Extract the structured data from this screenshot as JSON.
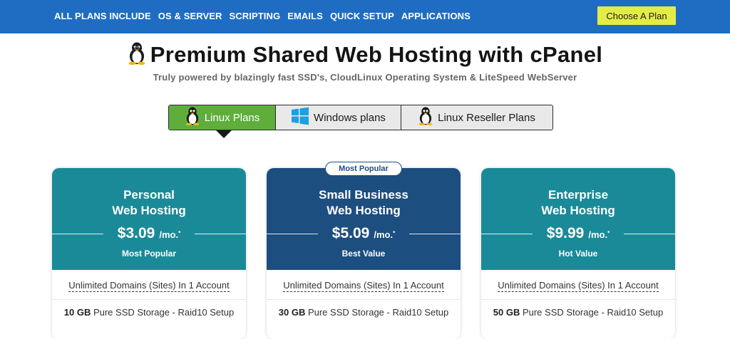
{
  "nav": {
    "items": [
      "ALL PLANS INCLUDE",
      "OS & SERVER",
      "SCRIPTING",
      "EMAILS",
      "QUICK SETUP",
      "APPLICATIONS"
    ],
    "cta_label": "Choose A Plan"
  },
  "header": {
    "title": "Premium Shared Web Hosting with cPanel",
    "subtitle": "Truly powered by blazingly fast SSD's, CloudLinux Operating System & LiteSpeed WebServer",
    "title_icon": "linux-tux-icon"
  },
  "tabs": [
    {
      "label": "Linux Plans",
      "icon": "linux-tux-icon",
      "active": true
    },
    {
      "label": "Windows plans",
      "icon": "windows-logo-icon",
      "active": false
    },
    {
      "label": "Linux Reseller Plans",
      "icon": "linux-tux-icon",
      "active": false
    }
  ],
  "popular_pill": "Most Popular",
  "plans": [
    {
      "name_line1": "Personal",
      "name_line2": "Web Hosting",
      "price": "$3.09",
      "per": "/mo.",
      "star": "*",
      "badge": "Most Popular",
      "color": "#1a8a99",
      "feature1": "Unlimited Domains (Sites) In 1 Account",
      "storage_amount": "10 GB",
      "storage_text": " Pure SSD Storage - Raid10 Setup"
    },
    {
      "name_line1": "Small Business",
      "name_line2": "Web Hosting",
      "price": "$5.09",
      "per": "/mo.",
      "star": "*",
      "badge": "Best Value",
      "color": "#1c4e80",
      "feature1": "Unlimited Domains (Sites) In 1 Account",
      "storage_amount": "30 GB",
      "storage_text": " Pure SSD Storage - Raid10 Setup"
    },
    {
      "name_line1": "Enterprise",
      "name_line2": "Web Hosting",
      "price": "$9.99",
      "per": "/mo.",
      "star": "*",
      "badge": "Hot Value",
      "color": "#1a8a99",
      "feature1": "Unlimited Domains (Sites) In 1 Account",
      "storage_amount": "50 GB",
      "storage_text": " Pure SSD Storage - Raid10 Setup"
    }
  ],
  "colors": {
    "topbar": "#1f6dc3",
    "cta": "#e3ec46",
    "tab_active": "#5fae3c",
    "teal": "#1a8a99",
    "navy": "#1c4e80"
  }
}
